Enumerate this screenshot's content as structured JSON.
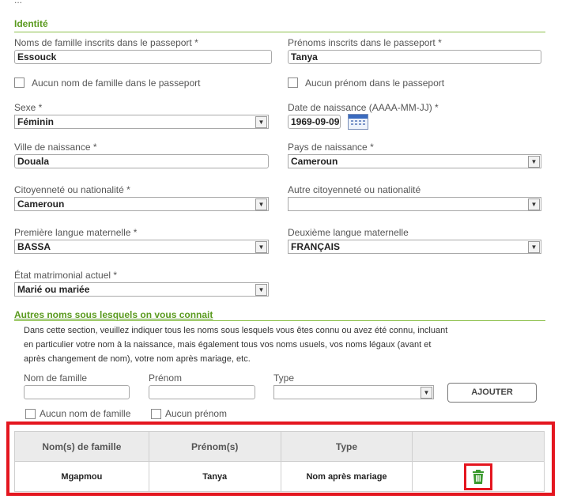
{
  "header_partial": "...",
  "identite": {
    "title": "Identité",
    "surname_label": "Noms de famille inscrits dans le passeport *",
    "surname_value": "Essouck",
    "given_label": "Prénoms inscrits dans le passeport *",
    "given_value": "Tanya",
    "no_surname_label": "Aucun nom de famille dans le passeport",
    "no_given_label": "Aucun prénom dans le passeport",
    "sex_label": "Sexe *",
    "sex_value": "Féminin",
    "dob_label": "Date de naissance (AAAA-MM-JJ) *",
    "dob_value": "1969-09-09",
    "birth_city_label": "Ville de naissance *",
    "birth_city_value": "Douala",
    "birth_country_label": "Pays de naissance *",
    "birth_country_value": "Cameroun",
    "citizenship_label": "Citoyenneté ou nationalité *",
    "citizenship_value": "Cameroun",
    "other_citizenship_label": "Autre citoyenneté ou nationalité",
    "other_citizenship_value": "",
    "first_lang_label": "Première langue maternelle *",
    "first_lang_value": "BASSA",
    "second_lang_label": "Deuxième langue maternelle",
    "second_lang_value": "FRANÇAIS",
    "marital_label": "État matrimonial actuel *",
    "marital_value": "Marié ou mariée"
  },
  "autres_noms": {
    "title": "Autres noms sous lesquels on vous connait",
    "description": "Dans cette section, veuillez indiquer tous les noms sous lesquels vous êtes connu ou avez été connu, incluant en particulier votre nom à la naissance, mais également tous vos noms usuels, vos noms légaux (avant et après changement de nom), votre nom après mariage, etc.",
    "surname_label": "Nom de famille",
    "given_label": "Prénom",
    "type_label": "Type",
    "add_button": "AJOUTER",
    "no_surname_label": "Aucun nom de famille",
    "no_given_label": "Aucun prénom",
    "table_headers": [
      "Nom(s) de famille",
      "Prénom(s)",
      "Type"
    ],
    "rows": [
      {
        "surname": "Mgapmou",
        "given": "Tanya",
        "type": "Nom après mariage"
      }
    ]
  },
  "icons": {
    "dropdown": "chevron-down-icon",
    "calendar": "calendar-icon",
    "delete": "trash-icon"
  },
  "colors": {
    "section": "#5a9a1e",
    "highlight": "#e4161f",
    "delete_icon": "#3a9a2e"
  }
}
